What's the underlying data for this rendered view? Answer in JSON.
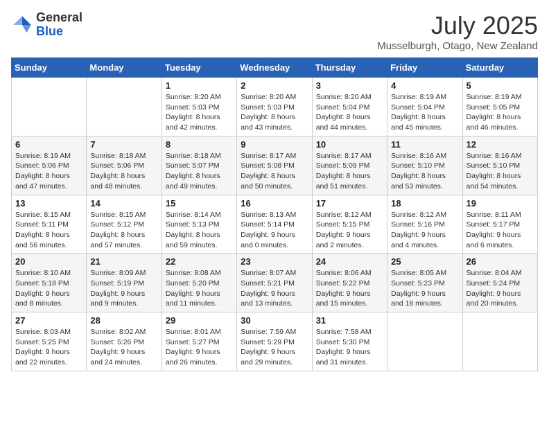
{
  "header": {
    "logo_general": "General",
    "logo_blue": "Blue",
    "month_title": "July 2025",
    "location": "Musselburgh, Otago, New Zealand"
  },
  "days_of_week": [
    "Sunday",
    "Monday",
    "Tuesday",
    "Wednesday",
    "Thursday",
    "Friday",
    "Saturday"
  ],
  "weeks": [
    [
      {
        "day": "",
        "info": ""
      },
      {
        "day": "",
        "info": ""
      },
      {
        "day": "1",
        "info": "Sunrise: 8:20 AM\nSunset: 5:03 PM\nDaylight: 8 hours and 42 minutes."
      },
      {
        "day": "2",
        "info": "Sunrise: 8:20 AM\nSunset: 5:03 PM\nDaylight: 8 hours and 43 minutes."
      },
      {
        "day": "3",
        "info": "Sunrise: 8:20 AM\nSunset: 5:04 PM\nDaylight: 8 hours and 44 minutes."
      },
      {
        "day": "4",
        "info": "Sunrise: 8:19 AM\nSunset: 5:04 PM\nDaylight: 8 hours and 45 minutes."
      },
      {
        "day": "5",
        "info": "Sunrise: 8:19 AM\nSunset: 5:05 PM\nDaylight: 8 hours and 46 minutes."
      }
    ],
    [
      {
        "day": "6",
        "info": "Sunrise: 8:19 AM\nSunset: 5:06 PM\nDaylight: 8 hours and 47 minutes."
      },
      {
        "day": "7",
        "info": "Sunrise: 8:18 AM\nSunset: 5:06 PM\nDaylight: 8 hours and 48 minutes."
      },
      {
        "day": "8",
        "info": "Sunrise: 8:18 AM\nSunset: 5:07 PM\nDaylight: 8 hours and 49 minutes."
      },
      {
        "day": "9",
        "info": "Sunrise: 8:17 AM\nSunset: 5:08 PM\nDaylight: 8 hours and 50 minutes."
      },
      {
        "day": "10",
        "info": "Sunrise: 8:17 AM\nSunset: 5:09 PM\nDaylight: 8 hours and 51 minutes."
      },
      {
        "day": "11",
        "info": "Sunrise: 8:16 AM\nSunset: 5:10 PM\nDaylight: 8 hours and 53 minutes."
      },
      {
        "day": "12",
        "info": "Sunrise: 8:16 AM\nSunset: 5:10 PM\nDaylight: 8 hours and 54 minutes."
      }
    ],
    [
      {
        "day": "13",
        "info": "Sunrise: 8:15 AM\nSunset: 5:11 PM\nDaylight: 8 hours and 56 minutes."
      },
      {
        "day": "14",
        "info": "Sunrise: 8:15 AM\nSunset: 5:12 PM\nDaylight: 8 hours and 57 minutes."
      },
      {
        "day": "15",
        "info": "Sunrise: 8:14 AM\nSunset: 5:13 PM\nDaylight: 8 hours and 59 minutes."
      },
      {
        "day": "16",
        "info": "Sunrise: 8:13 AM\nSunset: 5:14 PM\nDaylight: 9 hours and 0 minutes."
      },
      {
        "day": "17",
        "info": "Sunrise: 8:12 AM\nSunset: 5:15 PM\nDaylight: 9 hours and 2 minutes."
      },
      {
        "day": "18",
        "info": "Sunrise: 8:12 AM\nSunset: 5:16 PM\nDaylight: 9 hours and 4 minutes."
      },
      {
        "day": "19",
        "info": "Sunrise: 8:11 AM\nSunset: 5:17 PM\nDaylight: 9 hours and 6 minutes."
      }
    ],
    [
      {
        "day": "20",
        "info": "Sunrise: 8:10 AM\nSunset: 5:18 PM\nDaylight: 9 hours and 8 minutes."
      },
      {
        "day": "21",
        "info": "Sunrise: 8:09 AM\nSunset: 5:19 PM\nDaylight: 9 hours and 9 minutes."
      },
      {
        "day": "22",
        "info": "Sunrise: 8:08 AM\nSunset: 5:20 PM\nDaylight: 9 hours and 11 minutes."
      },
      {
        "day": "23",
        "info": "Sunrise: 8:07 AM\nSunset: 5:21 PM\nDaylight: 9 hours and 13 minutes."
      },
      {
        "day": "24",
        "info": "Sunrise: 8:06 AM\nSunset: 5:22 PM\nDaylight: 9 hours and 15 minutes."
      },
      {
        "day": "25",
        "info": "Sunrise: 8:05 AM\nSunset: 5:23 PM\nDaylight: 9 hours and 18 minutes."
      },
      {
        "day": "26",
        "info": "Sunrise: 8:04 AM\nSunset: 5:24 PM\nDaylight: 9 hours and 20 minutes."
      }
    ],
    [
      {
        "day": "27",
        "info": "Sunrise: 8:03 AM\nSunset: 5:25 PM\nDaylight: 9 hours and 22 minutes."
      },
      {
        "day": "28",
        "info": "Sunrise: 8:02 AM\nSunset: 5:26 PM\nDaylight: 9 hours and 24 minutes."
      },
      {
        "day": "29",
        "info": "Sunrise: 8:01 AM\nSunset: 5:27 PM\nDaylight: 9 hours and 26 minutes."
      },
      {
        "day": "30",
        "info": "Sunrise: 7:59 AM\nSunset: 5:29 PM\nDaylight: 9 hours and 29 minutes."
      },
      {
        "day": "31",
        "info": "Sunrise: 7:58 AM\nSunset: 5:30 PM\nDaylight: 9 hours and 31 minutes."
      },
      {
        "day": "",
        "info": ""
      },
      {
        "day": "",
        "info": ""
      }
    ]
  ]
}
